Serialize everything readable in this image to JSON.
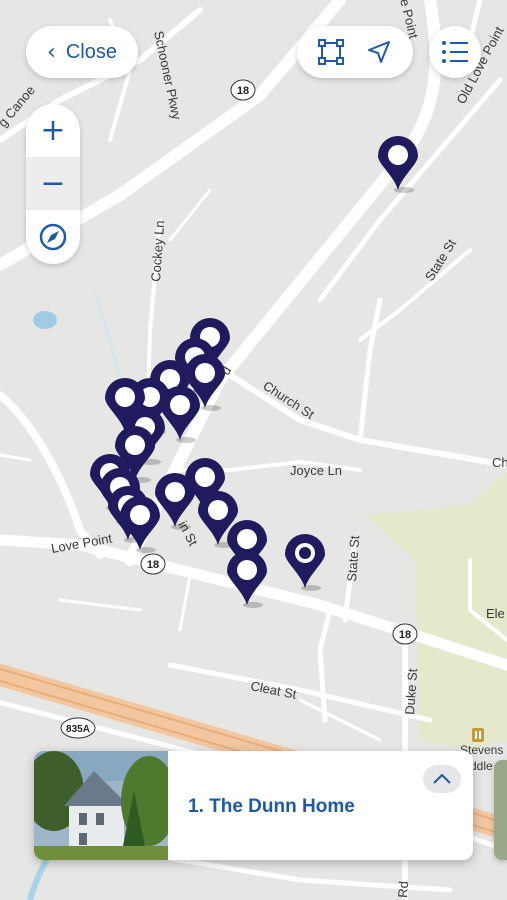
{
  "controls": {
    "close_label": "Close",
    "zoom_in": "+",
    "zoom_out": "−"
  },
  "streets": {
    "schooner": "Schooner Pkwy",
    "canoe": "g Canoe",
    "cockey": "Cockey Ln",
    "state_top": "State St",
    "state_lower": "State St",
    "church": "Church St",
    "joyce": "Joyce Ln",
    "love_point_left": "Love Point",
    "main_partial": "in St",
    "cleat": "Cleat St",
    "duke": "Duke St",
    "old_love_point": "Old Love Point",
    "love_point_top": "e Point",
    "ch_partial": "Ch",
    "rd_partial": "Rd",
    "ele_partial": "Ele",
    "stevens_partial": "Stevens",
    "ddle_partial": "ddle",
    "d_partial": "d"
  },
  "route_shields": {
    "r18_top": "18",
    "r18_mid": "18",
    "r18_right": "18",
    "r835a": "835A"
  },
  "card": {
    "title": "1. The Dunn Home"
  },
  "colors": {
    "marker": "#1f1b5e",
    "accent": "#1e5aa8",
    "map_bg": "#e6e6e4",
    "road": "#ffffff",
    "water": "#a9d3ea",
    "highway": "#f3c9a3",
    "green_area": "#e2e6c8"
  }
}
